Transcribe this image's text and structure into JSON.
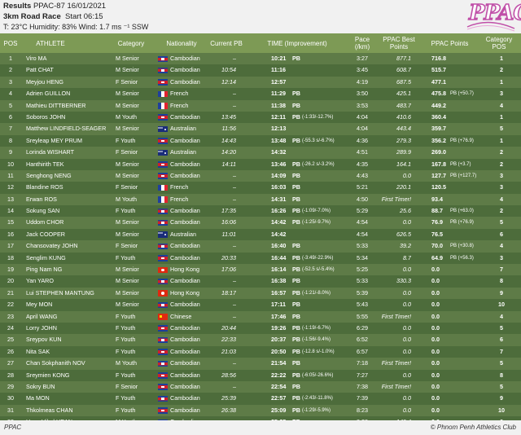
{
  "header": {
    "results_label": "Results",
    "event_code": "PPAC-87",
    "date": "16/01/2021",
    "race_name": "3km Road Race",
    "start": "Start 06:15",
    "conditions": "T: 23°C   Humidity: 83%   Wind: 1.7 ms ⁻¹ SSW"
  },
  "logo_text": "PPAC",
  "columns": {
    "pos": "POS",
    "athlete": "ATHLETE",
    "category": "Category",
    "nationality": "Nationality",
    "current_pb": "Current PB",
    "time": "TIME (Improvement)",
    "pace": "Pace (/km)",
    "best_points": "PPAC Best Points",
    "points": "PPAC Points",
    "category_pos": "Category POS"
  },
  "rows": [
    {
      "pos": "1",
      "athlete": "Viro MA",
      "category": "M Senior",
      "flag": "kh",
      "nationality": "Cambodian",
      "pb": "–",
      "time": "10:21",
      "time_pb": "PB",
      "improvement": "",
      "pace": "3:27",
      "best_points": "877.1",
      "points": "716.8",
      "points_delta": "",
      "cat_pos": "1"
    },
    {
      "pos": "2",
      "athlete": "Patt CHAT",
      "category": "M Senior",
      "flag": "kh",
      "nationality": "Cambodian",
      "pb": "10:54",
      "time": "11:16",
      "time_pb": "",
      "improvement": "",
      "pace": "3:45",
      "best_points": "608.7",
      "points": "515.7",
      "points_delta": "",
      "cat_pos": "2"
    },
    {
      "pos": "3",
      "athlete": "Meyjou HENG",
      "category": "F Senior",
      "flag": "kh",
      "nationality": "Cambodian",
      "pb": "12:14",
      "time": "12:57",
      "time_pb": "",
      "improvement": "",
      "pace": "4:19",
      "best_points": "687.5",
      "points": "477.1",
      "points_delta": "",
      "cat_pos": "1"
    },
    {
      "pos": "4",
      "athlete": "Adrien GUILLON",
      "category": "M Senior",
      "flag": "fr",
      "nationality": "French",
      "pb": "–",
      "time": "11:29",
      "time_pb": "PB",
      "improvement": "",
      "pace": "3:50",
      "best_points": "425.1",
      "points": "475.8",
      "points_delta": "PB (+50.7)",
      "cat_pos": "3"
    },
    {
      "pos": "5",
      "athlete": "Mathieu DITTBERNER",
      "category": "M Senior",
      "flag": "fr",
      "nationality": "French",
      "pb": "–",
      "time": "11:38",
      "time_pb": "PB",
      "improvement": "",
      "pace": "3:53",
      "best_points": "483.7",
      "points": "449.2",
      "points_delta": "",
      "cat_pos": "4"
    },
    {
      "pos": "6",
      "athlete": "Soboros JOHN",
      "category": "M Youth",
      "flag": "kh",
      "nationality": "Cambodian",
      "pb": "13:45",
      "time": "12:11",
      "time_pb": "PB",
      "improvement": "(-1:33/-12.7%)",
      "pace": "4:04",
      "best_points": "410.6",
      "points": "360.4",
      "points_delta": "",
      "cat_pos": "1"
    },
    {
      "pos": "7",
      "athlete": "Matthew LINDFIELD-SEAGER",
      "category": "M Senior",
      "flag": "au",
      "nationality": "Australian",
      "pb": "11:56",
      "time": "12:13",
      "time_pb": "",
      "improvement": "",
      "pace": "4:04",
      "best_points": "443.4",
      "points": "359.7",
      "points_delta": "",
      "cat_pos": "5"
    },
    {
      "pos": "8",
      "athlete": "Sreyleap MEY PRUM",
      "category": "F Youth",
      "flag": "kh",
      "nationality": "Cambodian",
      "pb": "14:43",
      "time": "13:48",
      "time_pb": "PB",
      "improvement": "(-55.3 s/-6.7%)",
      "pace": "4:36",
      "best_points": "279.3",
      "points": "356.2",
      "points_delta": "PB (+76.9)",
      "cat_pos": "1"
    },
    {
      "pos": "9",
      "athlete": "Lorinda WISHART",
      "category": "F Senior",
      "flag": "au",
      "nationality": "Australian",
      "pb": "14:20",
      "time": "14:32",
      "time_pb": "",
      "improvement": "",
      "pace": "4:51",
      "best_points": "289.9",
      "points": "269.0",
      "points_delta": "",
      "cat_pos": "2"
    },
    {
      "pos": "10",
      "athlete": "Hanthirith TEK",
      "category": "M Senior",
      "flag": "kh",
      "nationality": "Cambodian",
      "pb": "14:11",
      "time": "13:46",
      "time_pb": "PB",
      "improvement": "(-26.2 s/-3.2%)",
      "pace": "4:35",
      "best_points": "164.1",
      "points": "167.8",
      "points_delta": "PB (+3.7)",
      "cat_pos": "2"
    },
    {
      "pos": "11",
      "athlete": "Senghong NENG",
      "category": "M Senior",
      "flag": "kh",
      "nationality": "Cambodian",
      "pb": "–",
      "time": "14:09",
      "time_pb": "PB",
      "improvement": "",
      "pace": "4:43",
      "best_points": "0.0",
      "points": "127.7",
      "points_delta": "PB (+127.7)",
      "cat_pos": "3"
    },
    {
      "pos": "12",
      "athlete": "Blandine ROS",
      "category": "F Senior",
      "flag": "fr",
      "nationality": "French",
      "pb": "–",
      "time": "16:03",
      "time_pb": "PB",
      "improvement": "",
      "pace": "5:21",
      "best_points": "220.1",
      "points": "120.5",
      "points_delta": "",
      "cat_pos": "3"
    },
    {
      "pos": "13",
      "athlete": "Erwan ROS",
      "category": "M Youth",
      "flag": "fr",
      "nationality": "French",
      "pb": "–",
      "time": "14:31",
      "time_pb": "PB",
      "improvement": "",
      "pace": "4:50",
      "best_points": "First Timer!",
      "points": "93.4",
      "points_delta": "",
      "cat_pos": "4"
    },
    {
      "pos": "14",
      "athlete": "Sokung SAN",
      "category": "F Youth",
      "flag": "kh",
      "nationality": "Cambodian",
      "pb": "17:35",
      "time": "16:26",
      "time_pb": "PB",
      "improvement": "(-1:09/-7.0%)",
      "pace": "5:29",
      "best_points": "25.6",
      "points": "88.7",
      "points_delta": "PB (+63.0)",
      "cat_pos": "2"
    },
    {
      "pos": "15",
      "athlete": "Uddom CHOR",
      "category": "M Senior",
      "flag": "kh",
      "nationality": "Cambodian",
      "pb": "16:06",
      "time": "14:42",
      "time_pb": "PB",
      "improvement": "(-1:25/-9.7%)",
      "pace": "4:54",
      "best_points": "0.0",
      "points": "76.9",
      "points_delta": "PB (+76.9)",
      "cat_pos": "5"
    },
    {
      "pos": "16",
      "athlete": "Jack COOPER",
      "category": "M Senior",
      "flag": "au",
      "nationality": "Australian",
      "pb": "11:01",
      "time": "14:42",
      "time_pb": "",
      "improvement": "",
      "pace": "4:54",
      "best_points": "626.5",
      "points": "76.5",
      "points_delta": "",
      "cat_pos": "6"
    },
    {
      "pos": "17",
      "athlete": "Chansovatey JOHN",
      "category": "F Senior",
      "flag": "kh",
      "nationality": "Cambodian",
      "pb": "–",
      "time": "16:40",
      "time_pb": "PB",
      "improvement": "",
      "pace": "5:33",
      "best_points": "39.2",
      "points": "70.0",
      "points_delta": "PB (+30.8)",
      "cat_pos": "4"
    },
    {
      "pos": "18",
      "athlete": "Senglim KUNG",
      "category": "F Youth",
      "flag": "kh",
      "nationality": "Cambodian",
      "pb": "20:33",
      "time": "16:44",
      "time_pb": "PB",
      "improvement": "(-3:49/-22.9%)",
      "pace": "5:34",
      "best_points": "8.7",
      "points": "64.9",
      "points_delta": "PB (+56.3)",
      "cat_pos": "3"
    },
    {
      "pos": "19",
      "athlete": "Ping Nam NG",
      "category": "M Senior",
      "flag": "hk",
      "nationality": "Hong Kong",
      "pb": "17:06",
      "time": "16:14",
      "time_pb": "PB",
      "improvement": "(-52.5 s/-5.4%)",
      "pace": "5:25",
      "best_points": "0.0",
      "points": "0.0",
      "points_delta": "",
      "cat_pos": "7"
    },
    {
      "pos": "20",
      "athlete": "Yan YARO",
      "category": "M Senior",
      "flag": "kh",
      "nationality": "Cambodian",
      "pb": "–",
      "time": "16:38",
      "time_pb": "PB",
      "improvement": "",
      "pace": "5:33",
      "best_points": "330.3",
      "points": "0.0",
      "points_delta": "",
      "cat_pos": "8"
    },
    {
      "pos": "21",
      "athlete": "Lui STEPHEN MANTUNG",
      "category": "M Senior",
      "flag": "hk",
      "nationality": "Hong Kong",
      "pb": "18:17",
      "time": "16:57",
      "time_pb": "PB",
      "improvement": "(-1:21/-8.0%)",
      "pace": "5:39",
      "best_points": "0.0",
      "points": "0.0",
      "points_delta": "",
      "cat_pos": "9"
    },
    {
      "pos": "22",
      "athlete": "Mey MON",
      "category": "M Senior",
      "flag": "kh",
      "nationality": "Cambodian",
      "pb": "–",
      "time": "17:11",
      "time_pb": "PB",
      "improvement": "",
      "pace": "5:43",
      "best_points": "0.0",
      "points": "0.0",
      "points_delta": "",
      "cat_pos": "10"
    },
    {
      "pos": "23",
      "athlete": "April WANG",
      "category": "F Youth",
      "flag": "cn",
      "nationality": "Chinese",
      "pb": "–",
      "time": "17:46",
      "time_pb": "PB",
      "improvement": "",
      "pace": "5:55",
      "best_points": "First Timer!",
      "points": "0.0",
      "points_delta": "",
      "cat_pos": "4"
    },
    {
      "pos": "24",
      "athlete": "Lorry JOHN",
      "category": "F Youth",
      "flag": "kh",
      "nationality": "Cambodian",
      "pb": "20:44",
      "time": "19:26",
      "time_pb": "PB",
      "improvement": "(-1:19/-6.7%)",
      "pace": "6:29",
      "best_points": "0.0",
      "points": "0.0",
      "points_delta": "",
      "cat_pos": "5"
    },
    {
      "pos": "25",
      "athlete": "Sreypov KUN",
      "category": "F Youth",
      "flag": "kh",
      "nationality": "Cambodian",
      "pb": "22:33",
      "time": "20:37",
      "time_pb": "PB",
      "improvement": "(-1:56/-9.4%)",
      "pace": "6:52",
      "best_points": "0.0",
      "points": "0.0",
      "points_delta": "",
      "cat_pos": "6"
    },
    {
      "pos": "26",
      "athlete": "Nita SAK",
      "category": "F Youth",
      "flag": "kh",
      "nationality": "Cambodian",
      "pb": "21:03",
      "time": "20:50",
      "time_pb": "PB",
      "improvement": "(-12.8 s/-1.0%)",
      "pace": "6:57",
      "best_points": "0.0",
      "points": "0.0",
      "points_delta": "",
      "cat_pos": "7"
    },
    {
      "pos": "27",
      "athlete": "Chan Sokphanith NOV",
      "category": "M Youth",
      "flag": "kh",
      "nationality": "Cambodian",
      "pb": "–",
      "time": "21:54",
      "time_pb": "PB",
      "improvement": "",
      "pace": "7:18",
      "best_points": "First Timer!",
      "points": "0.0",
      "points_delta": "",
      "cat_pos": "5"
    },
    {
      "pos": "28",
      "athlete": "Sreymien KONG",
      "category": "F Youth",
      "flag": "kh",
      "nationality": "Cambodian",
      "pb": "28:56",
      "time": "22:22",
      "time_pb": "PB",
      "improvement": "(-6:05/-26.6%)",
      "pace": "7:27",
      "best_points": "0.0",
      "points": "0.0",
      "points_delta": "",
      "cat_pos": "8"
    },
    {
      "pos": "29",
      "athlete": "Sokry BUN",
      "category": "F Senior",
      "flag": "kh",
      "nationality": "Cambodian",
      "pb": "–",
      "time": "22:54",
      "time_pb": "PB",
      "improvement": "",
      "pace": "7:38",
      "best_points": "First Timer!",
      "points": "0.0",
      "points_delta": "",
      "cat_pos": "5"
    },
    {
      "pos": "30",
      "athlete": "Ma MON",
      "category": "F Youth",
      "flag": "kh",
      "nationality": "Cambodian",
      "pb": "25:39",
      "time": "22:57",
      "time_pb": "PB",
      "improvement": "(-2:43/-11.8%)",
      "pace": "7:39",
      "best_points": "0.0",
      "points": "0.0",
      "points_delta": "",
      "cat_pos": "9"
    },
    {
      "pos": "31",
      "athlete": "Thkolmeas CHAN",
      "category": "F Youth",
      "flag": "kh",
      "nationality": "Cambodian",
      "pb": "26:38",
      "time": "25:09",
      "time_pb": "PB",
      "improvement": "(-1:29/-5.9%)",
      "pace": "8:23",
      "best_points": "0.0",
      "points": "0.0",
      "points_delta": "",
      "cat_pos": "10"
    },
    {
      "pos": "32",
      "athlete": "Heng Vibol HEAN",
      "category": "M Youth",
      "flag": "kh",
      "nationality": "Cambodian",
      "pb": "–",
      "time": "25:25",
      "time_pb": "PB",
      "improvement": "",
      "pace": "8:28",
      "best_points": "149.4",
      "points": "0.0",
      "points_delta": "",
      "cat_pos": "6"
    }
  ],
  "footer": {
    "left": "PPAC",
    "right": "© Phnom Penh Athletics Club"
  },
  "colors": {
    "background": "#4f6e3c",
    "row_light": "#5e7b47",
    "row_dark": "#4d6c3b",
    "header_row": "#7d9a55",
    "logo_accent": "#c04fa8"
  }
}
